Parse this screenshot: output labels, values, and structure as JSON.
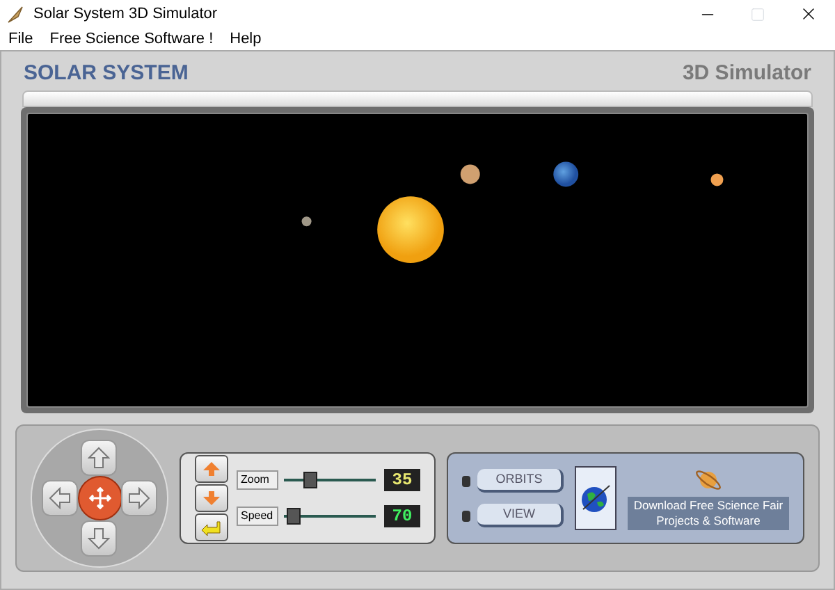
{
  "window": {
    "title": "Solar System 3D Simulator"
  },
  "menu": [
    "File",
    "Free Science Software !",
    "Help"
  ],
  "header": {
    "title": "SOLAR SYSTEM",
    "subtitle": "3D Simulator"
  },
  "sliders": [
    {
      "label": "Zoom",
      "level": 0.25,
      "reading": "35",
      "kind": "zoom"
    },
    {
      "label": "Speed",
      "level": 0.04,
      "reading": "70",
      "kind": "speed"
    }
  ],
  "buttons": [
    "ORBITS",
    "VIEW"
  ],
  "promo": "Download Free Science Fair Projects & Software"
}
